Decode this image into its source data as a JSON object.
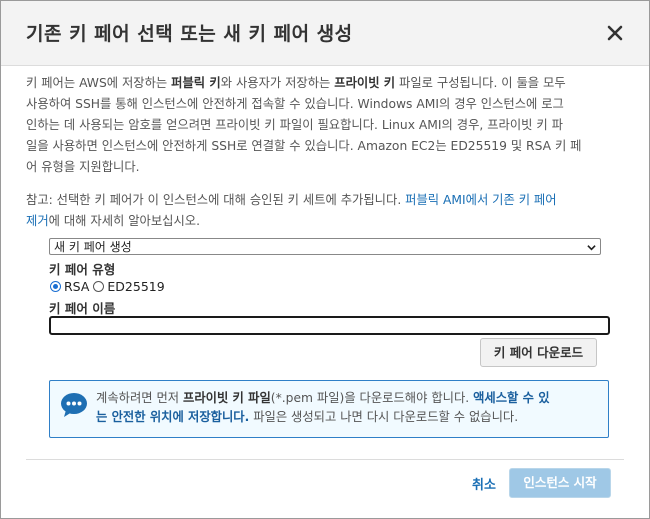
{
  "dialog": {
    "title": "기존 키 페어 선택 또는 새 키 페어 생성",
    "close_icon": "close-icon"
  },
  "description": {
    "line1": {
      "a": "키 페어는 AWS에 저장하는 ",
      "b": "퍼블릭 키",
      "c": "와 사용자가 저장하는 ",
      "d": "프라이빗 키",
      "e": " 파일로 구성됩니다. 이 둘을 모두"
    },
    "line2": "사용하여 SSH를 통해 인스턴스에 안전하게 접속할 수 있습니다. Windows AMI의 경우 인스턴스에 로그",
    "line3": "인하는 데 사용되는 암호를 얻으려면 프라이빗 키 파일이 필요합니다. Linux AMI의 경우, 프라이빗 키 파",
    "line4": "일을 사용하면 인스턴스에 안전하게 SSH로 연결할 수 있습니다. Amazon EC2는 ED25519 및 RSA 키 페",
    "line5": "어 유형을 지원합니다."
  },
  "note": {
    "prefix": "참고: 선택한 키 페어가 이 인스턴스에 대해 승인된 키 세트에 추가됩니다. ",
    "link_part1": "퍼블릭 AMI에서 기존 키 페어",
    "link_part2": "제거",
    "suffix": "에 대해 자세히 알아보십시오."
  },
  "key_pair_select": {
    "selected": "새 키 페어 생성"
  },
  "key_type": {
    "label": "키 페어 유형",
    "options": [
      {
        "label": "RSA",
        "checked": true
      },
      {
        "label": "ED25519",
        "checked": false
      }
    ]
  },
  "key_name": {
    "label": "키 페어 이름",
    "value": ""
  },
  "download_button": "키 페어 다운로드",
  "info": {
    "icon": "chat-bubble-icon",
    "l1_a": "계속하려면 먼저 ",
    "l1_b": "프라이빗 키 파일",
    "l1_c": "(*.pem 파일)을 다운로드해야 합니다. ",
    "l1_d": "액세스할 수 있",
    "l2_a": "는 안전한 위치에 저장합니다.",
    "l2_b": " 파일은 생성되고 나면 다시 다운로드할 수 없습니다."
  },
  "footer": {
    "cancel": "취소",
    "launch": "인스턴스 시작"
  },
  "colors": {
    "link": "#1a6fb5",
    "info_border": "#2f7fc7",
    "info_bg": "#f1faff",
    "launch_disabled": "#9fc8e6"
  }
}
